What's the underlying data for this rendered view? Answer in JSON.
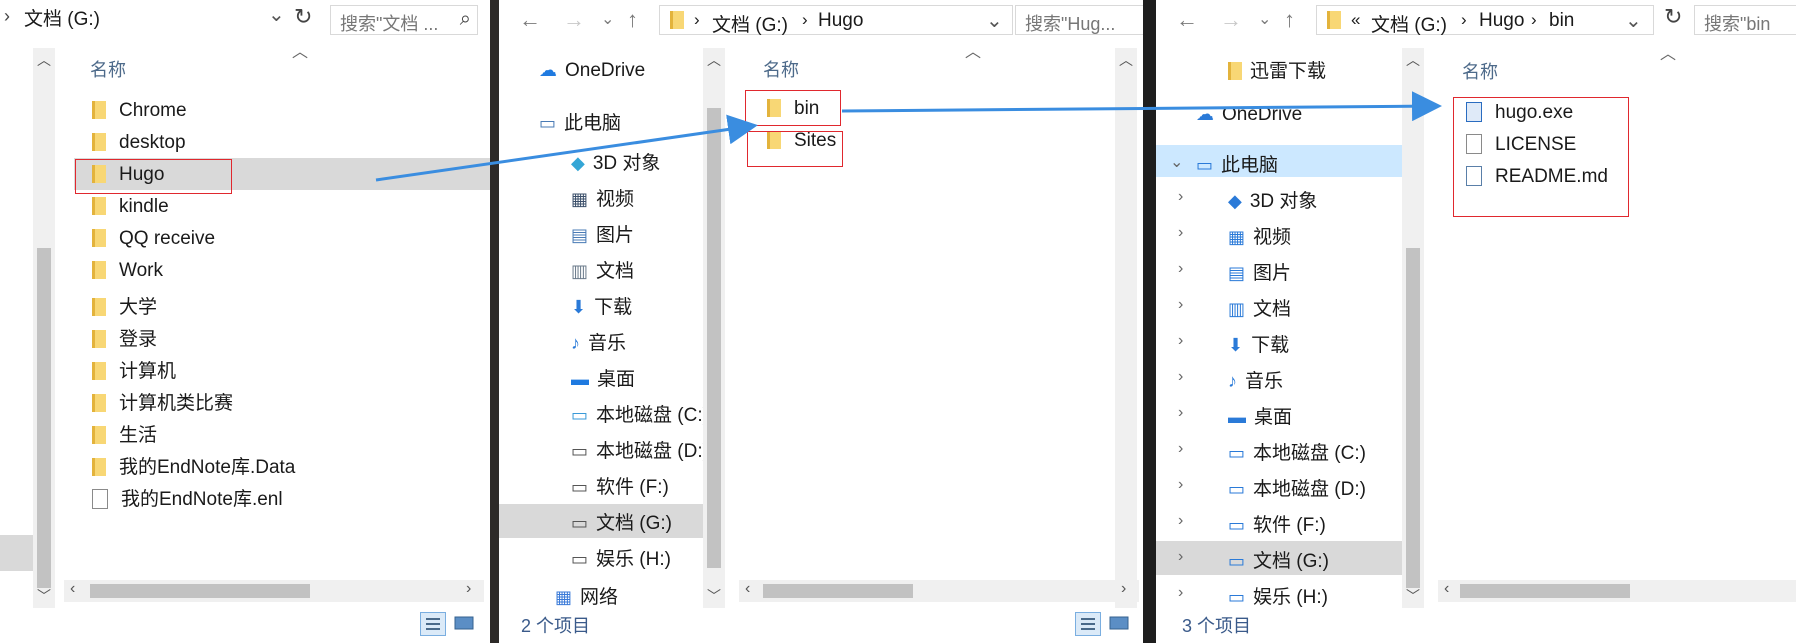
{
  "win1": {
    "address": "文档 (G:)",
    "search_placeholder": "搜索\"文档 ...",
    "column_name": "名称",
    "items": [
      {
        "label": "Chrome",
        "kind": "folder"
      },
      {
        "label": "desktop",
        "kind": "folder"
      },
      {
        "label": "Hugo",
        "kind": "folder"
      },
      {
        "label": "kindle",
        "kind": "folder"
      },
      {
        "label": "QQ  receive",
        "kind": "folder"
      },
      {
        "label": "Work",
        "kind": "folder"
      },
      {
        "label": "大学",
        "kind": "folder"
      },
      {
        "label": "登录",
        "kind": "folder"
      },
      {
        "label": "计算机",
        "kind": "folder"
      },
      {
        "label": "计算机类比赛",
        "kind": "folder"
      },
      {
        "label": "生活",
        "kind": "folder"
      },
      {
        "label": "我的EndNote库.Data",
        "kind": "folder"
      },
      {
        "label": "我的EndNote库.enl",
        "kind": "file"
      }
    ]
  },
  "win2": {
    "address_root": "文档 (G:)",
    "address_child": "Hugo",
    "search_placeholder": "搜索\"Hug...",
    "column_name": "名称",
    "nav": {
      "onedrive": "OneDrive",
      "this_pc": "此电脑",
      "objects3d": "3D 对象",
      "video": "视频",
      "pictures": "图片",
      "documents": "文档",
      "downloads": "下载",
      "music": "音乐",
      "desktop": "桌面",
      "drive_c": "本地磁盘 (C:)",
      "drive_d": "本地磁盘 (D:)",
      "drive_f": "软件 (F:)",
      "drive_g": "文档 (G:)",
      "drive_h": "娱乐 (H:)",
      "network": "网络"
    },
    "items": [
      {
        "label": "bin",
        "kind": "folder"
      },
      {
        "label": "Sites",
        "kind": "folder"
      }
    ],
    "status": "2 个项目"
  },
  "win3": {
    "address_ellipsis": "«",
    "address_root": "文档 (G:)",
    "address_mid": "Hugo",
    "address_child": "bin",
    "search_placeholder": "搜索\"bin",
    "column_name": "名称",
    "nav": {
      "xunlei": "迅雷下载",
      "onedrive": "OneDrive",
      "this_pc": "此电脑",
      "objects3d": "3D 对象",
      "video": "视频",
      "pictures": "图片",
      "documents": "文档",
      "downloads": "下载",
      "music": "音乐",
      "desktop": "桌面",
      "drive_c": "本地磁盘 (C:)",
      "drive_d": "本地磁盘 (D:)",
      "drive_f": "软件 (F:)",
      "drive_g": "文档 (G:)",
      "drive_h": "娱乐 (H:)"
    },
    "items": [
      {
        "label": "hugo.exe",
        "kind": "exe"
      },
      {
        "label": "LICENSE",
        "kind": "file"
      },
      {
        "label": "README.md",
        "kind": "md"
      }
    ],
    "status": "3 个项目"
  },
  "colors": {
    "annotation_arrow": "#3a8de0",
    "highlight_box": "#e0282e",
    "selection": "#d9d9d9"
  }
}
